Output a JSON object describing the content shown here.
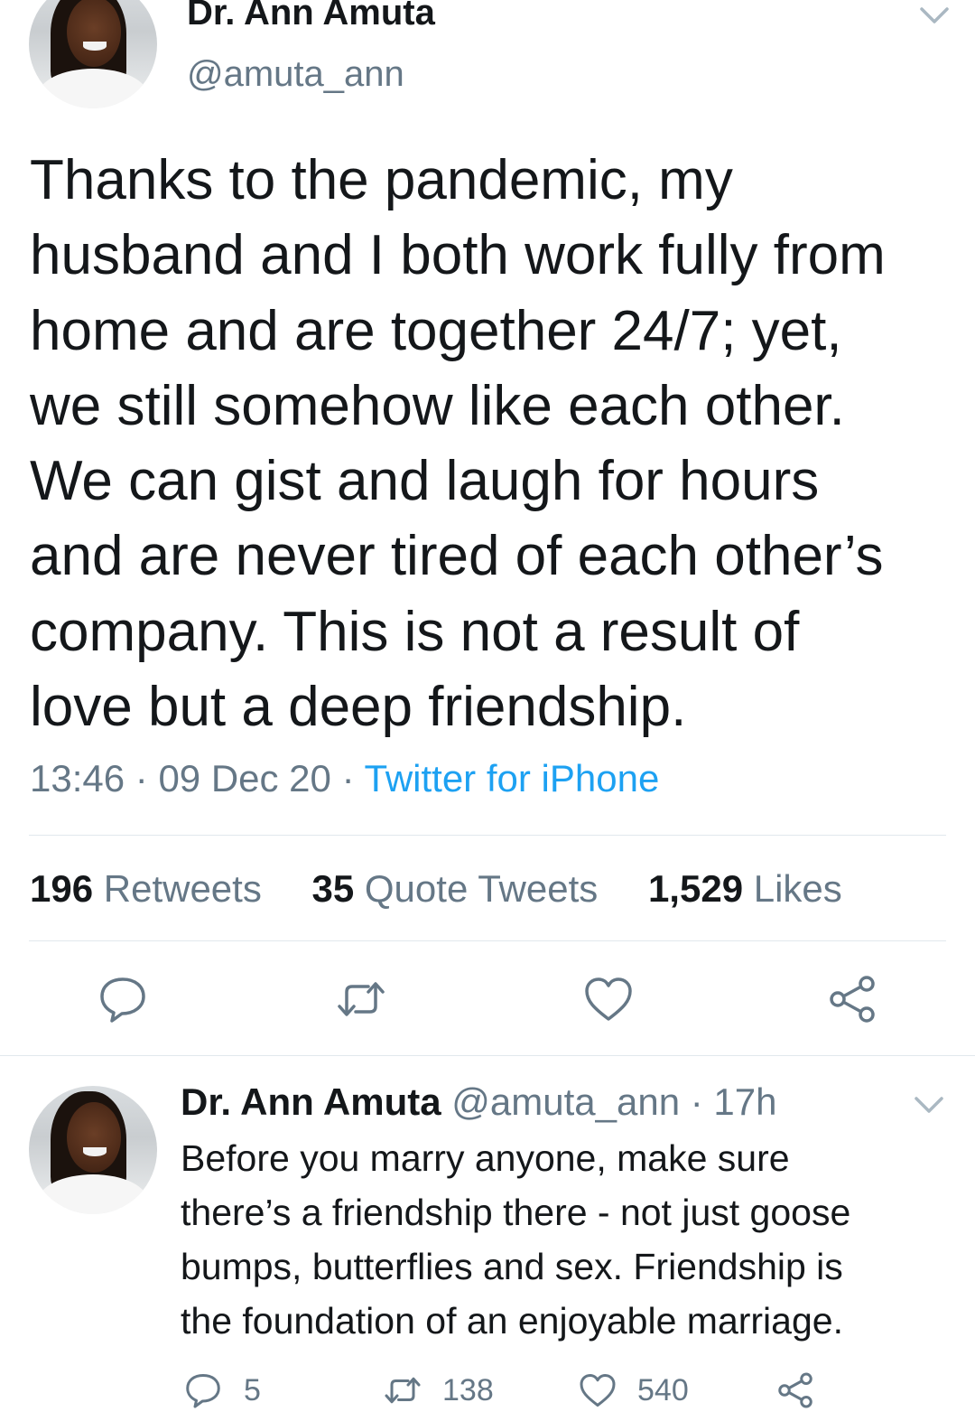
{
  "main_tweet": {
    "author_name": "Dr. Ann Amuta",
    "handle": "@amuta_ann",
    "text": "Thanks to the pandemic, my\nhusband and I both work fully from\nhome and are together 24/7; yet,\nwe still somehow like each other.\nWe can gist and laugh for hours\nand are never tired of each other’s\ncompany. This is not a result of\nlove but a deep friendship.",
    "time": "13:46",
    "date": "09 Dec 20",
    "source": "Twitter for iPhone",
    "stats": {
      "retweets_count": "196",
      "retweets_label": "Retweets",
      "quotes_count": "35",
      "quotes_label": "Quote Tweets",
      "likes_count": "1,529",
      "likes_label": "Likes"
    },
    "actions": [
      "reply-icon",
      "retweet-icon",
      "like-icon",
      "share-icon"
    ]
  },
  "reply_tweet": {
    "author_name": "Dr. Ann Amuta",
    "handle": "@amuta_ann",
    "age": "17h",
    "text": "Before you marry anyone, make sure\nthere’s a friendship there - not just goose\nbumps, butterflies and sex. Friendship is\nthe foundation of an enjoyable marriage.",
    "counts": {
      "replies": "5",
      "retweets": "138",
      "likes": "540"
    }
  },
  "colors": {
    "text": "#14171a",
    "secondary": "#657786",
    "link": "#1da1f2",
    "divider": "#e1e8ed"
  }
}
